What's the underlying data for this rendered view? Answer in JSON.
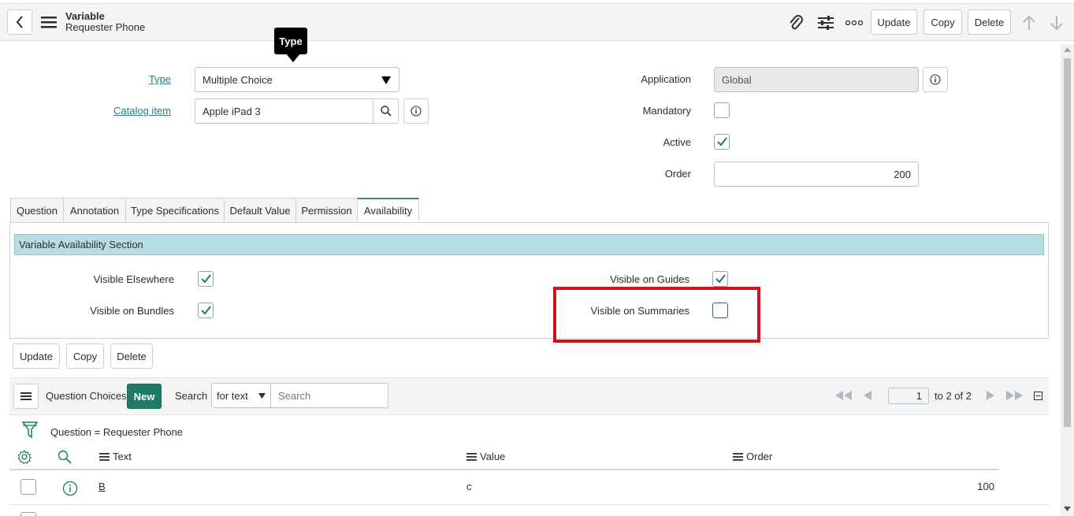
{
  "header": {
    "title": "Variable",
    "subtitle": "Requester Phone",
    "update_label": "Update",
    "copy_label": "Copy",
    "delete_label": "Delete"
  },
  "tooltip": {
    "text": "Type"
  },
  "form": {
    "type_label": "Type",
    "type_value": "Multiple Choice",
    "catalog_label": "Catalog item",
    "catalog_value": "Apple iPad 3",
    "application_label": "Application",
    "application_value": "Global",
    "mandatory_label": "Mandatory",
    "mandatory_checked": false,
    "active_label": "Active",
    "active_checked": true,
    "order_label": "Order",
    "order_value": "200"
  },
  "tabs": [
    {
      "label": "Question"
    },
    {
      "label": "Annotation"
    },
    {
      "label": "Type Specifications"
    },
    {
      "label": "Default Value"
    },
    {
      "label": "Permission"
    },
    {
      "label": "Availability"
    }
  ],
  "availability": {
    "section_title": "Variable Availability Section",
    "visible_elsewhere_label": "Visible Elsewhere",
    "visible_bundles_label": "Visible on Bundles",
    "visible_guides_label": "Visible on Guides",
    "visible_summaries_label": "Visible on Summaries",
    "highlight_color": "#d0111b"
  },
  "bottom_buttons": {
    "update_label": "Update",
    "copy_label": "Copy",
    "delete_label": "Delete"
  },
  "related_list": {
    "title": "Question Choices",
    "new_label": "New",
    "search_label": "Search",
    "search_type": "for text",
    "search_placeholder": "Search",
    "page_value": "1",
    "page_range": "to 2 of 2",
    "filter_text": "Question = Requester Phone",
    "columns": {
      "text": "Text",
      "value": "Value",
      "order": "Order"
    },
    "rows": [
      {
        "text": "B",
        "value": "c",
        "order": "100"
      }
    ]
  },
  "colors": {
    "accent": "#1f7a68",
    "section_bg": "#b5dde3",
    "header_bg": "#f3f4f5"
  }
}
